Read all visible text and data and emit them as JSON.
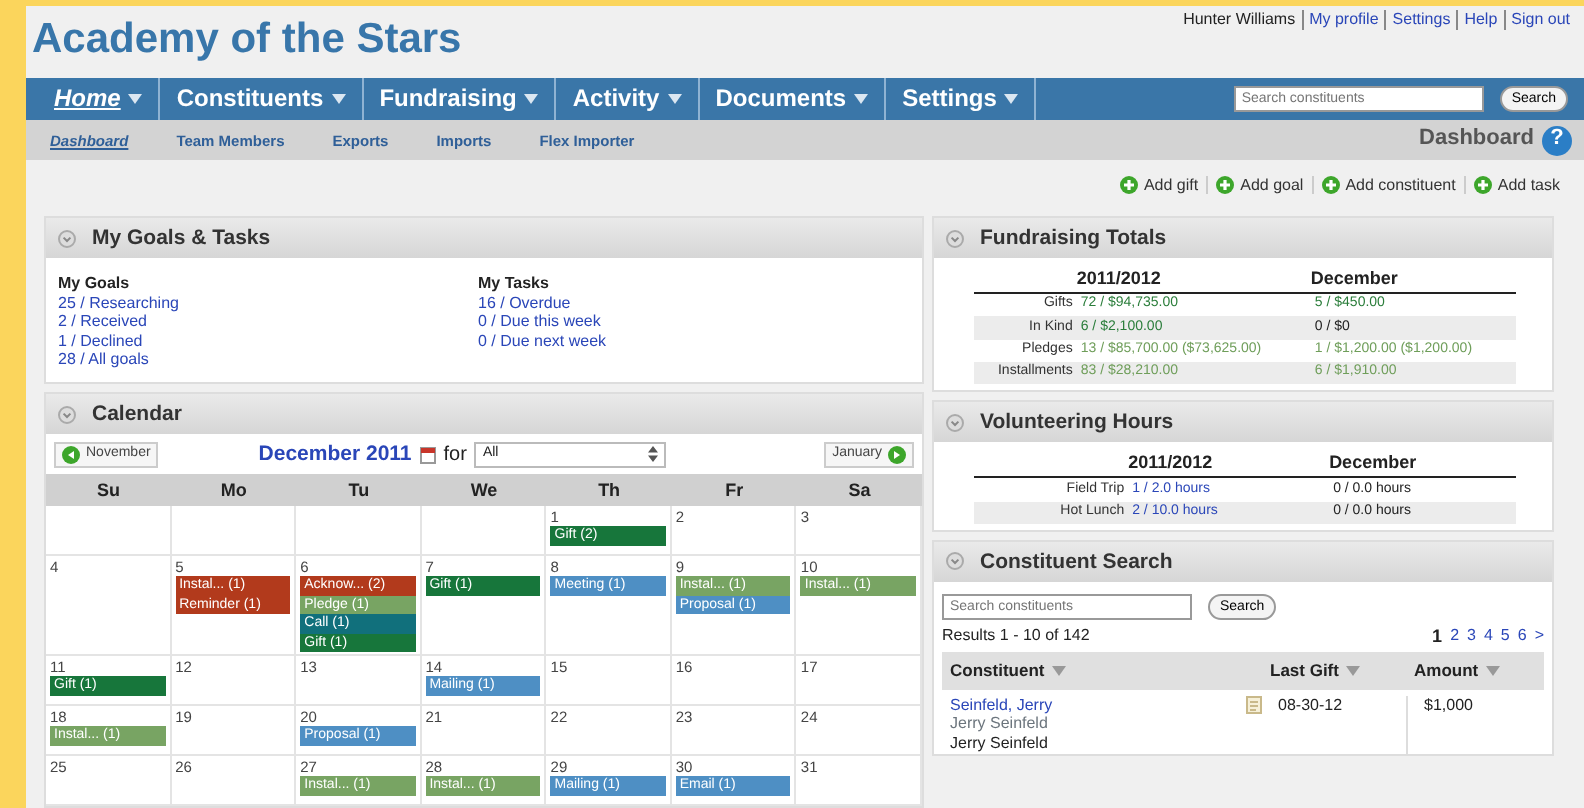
{
  "header": {
    "title": "Academy of the Stars",
    "user": "Hunter Williams",
    "links": [
      "My profile",
      "Settings",
      "Help",
      "Sign out"
    ]
  },
  "nav": {
    "items": [
      {
        "label": "Home",
        "selected": true
      },
      {
        "label": "Constituents",
        "selected": false
      },
      {
        "label": "Fundraising",
        "selected": false
      },
      {
        "label": "Activity",
        "selected": false
      },
      {
        "label": "Documents",
        "selected": false
      },
      {
        "label": "Settings",
        "selected": false
      }
    ],
    "search": {
      "placeholder": "Search constituents"
    },
    "search_button": "Search"
  },
  "subnav": {
    "items": [
      {
        "label": "Dashboard",
        "selected": true
      },
      {
        "label": "Team Members",
        "selected": false
      },
      {
        "label": "Exports",
        "selected": false
      },
      {
        "label": "Imports",
        "selected": false
      },
      {
        "label": "Flex Importer",
        "selected": false
      }
    ],
    "page_title": "Dashboard",
    "help": "?"
  },
  "actions": [
    "Add gift",
    "Add goal",
    "Add constituent",
    "Add task"
  ],
  "goals_panel": {
    "title": "My Goals & Tasks",
    "columns": [
      {
        "heading": "My Goals",
        "links": [
          "25 / Researching",
          "2 / Received",
          "1 / Declined",
          "28 / All goals"
        ]
      },
      {
        "heading": "My Tasks",
        "links": [
          "16 / Overdue",
          "0 / Due this week",
          "0 / Due next week"
        ]
      }
    ]
  },
  "calendar": {
    "title": "Calendar",
    "prev": "November",
    "month": "December 2011",
    "for": "for",
    "filter": "All",
    "next": "January",
    "weekdays": [
      "Su",
      "Mo",
      "Tu",
      "We",
      "Th",
      "Fr",
      "Sa"
    ],
    "weeks": [
      {
        "days": [
          {
            "kind": "blank"
          },
          {
            "kind": "blank"
          },
          {
            "kind": "blank"
          },
          {
            "kind": "blank"
          },
          {
            "kind": "date",
            "day": "1",
            "events": [
              {
                "label": "Gift (2)",
                "color": "#17763b"
              }
            ]
          },
          {
            "day": "2"
          },
          {
            "day": "3"
          }
        ]
      },
      {
        "days": [
          {
            "day": "4"
          },
          {
            "day": "5",
            "events": [
              {
                "label": "Instal... (1)",
                "color": "#b23a1c"
              },
              {
                "label": "Reminder (1)",
                "color": "#b23a1c"
              }
            ]
          },
          {
            "day": "6",
            "events": [
              {
                "label": "Acknow... (2)",
                "color": "#b23a1c"
              },
              {
                "label": "Pledge (1)",
                "color": "#78a463"
              },
              {
                "label": "Call (1)",
                "color": "#11707c"
              },
              {
                "label": "Gift (1)",
                "color": "#17763b"
              }
            ]
          },
          {
            "day": "7",
            "events": [
              {
                "label": "Gift (1)",
                "color": "#17763b"
              }
            ]
          },
          {
            "day": "8",
            "events": [
              {
                "label": "Meeting (1)",
                "color": "#4e8fc4"
              }
            ]
          },
          {
            "day": "9",
            "events": [
              {
                "label": "Instal... (1)",
                "color": "#78a463"
              },
              {
                "label": "Proposal (1)",
                "color": "#4e8fc4"
              }
            ]
          },
          {
            "day": "10",
            "events": [
              {
                "label": "Instal... (1)",
                "color": "#78a463"
              }
            ]
          }
        ]
      },
      {
        "days": [
          {
            "day": "11",
            "events": [
              {
                "label": "Gift (1)",
                "color": "#17763b"
              }
            ]
          },
          {
            "day": "12"
          },
          {
            "day": "13"
          },
          {
            "day": "14",
            "events": [
              {
                "label": "Mailing (1)",
                "color": "#4e8fc4"
              }
            ]
          },
          {
            "day": "15"
          },
          {
            "day": "16"
          },
          {
            "day": "17"
          }
        ]
      },
      {
        "days": [
          {
            "day": "18",
            "events": [
              {
                "label": "Instal... (1)",
                "color": "#78a463"
              }
            ]
          },
          {
            "day": "19"
          },
          {
            "day": "20",
            "events": [
              {
                "label": "Proposal (1)",
                "color": "#4e8fc4"
              }
            ]
          },
          {
            "day": "21"
          },
          {
            "day": "22"
          },
          {
            "day": "23"
          },
          {
            "day": "24"
          }
        ]
      },
      {
        "days": [
          {
            "day": "25"
          },
          {
            "day": "26"
          },
          {
            "day": "27",
            "events": [
              {
                "label": "Instal... (1)",
                "color": "#78a463"
              }
            ]
          },
          {
            "day": "28",
            "events": [
              {
                "label": "Instal... (1)",
                "color": "#78a463"
              }
            ]
          },
          {
            "day": "29",
            "events": [
              {
                "label": "Mailing (1)",
                "color": "#4e8fc4"
              }
            ]
          },
          {
            "day": "30",
            "events": [
              {
                "label": "Email (1)",
                "color": "#4e8fc4"
              }
            ]
          },
          {
            "day": "31"
          }
        ]
      }
    ]
  },
  "fundraising": {
    "title": "Fundraising Totals",
    "columns": [
      "2011/2012",
      "December"
    ],
    "rows": [
      {
        "label": "Gifts",
        "cells": [
          {
            "text": "72 / $94,735.00",
            "color": "#2a7d3a"
          },
          {
            "text": "5 / $450.00",
            "color": "#2a7d3a"
          }
        ]
      },
      {
        "label": "In Kind",
        "cells": [
          {
            "text": "6 / $2,100.00",
            "color": "#2a7d3a"
          },
          {
            "text": "0 / $0",
            "color": "#222222"
          }
        ]
      },
      {
        "label": "Pledges",
        "cells": [
          {
            "text": "13 / $85,700.00 ($73,625.00)",
            "color": "#6f9e5a"
          },
          {
            "text": "1 / $1,200.00 ($1,200.00)",
            "color": "#6f9e5a"
          }
        ]
      },
      {
        "label": "Installments",
        "cells": [
          {
            "text": "83 / $28,210.00",
            "color": "#6f9e5a"
          },
          {
            "text": "6 / $1,910.00",
            "color": "#6f9e5a"
          }
        ]
      }
    ]
  },
  "volunteering": {
    "title": "Volunteering Hours",
    "columns": [
      "2011/2012",
      "December"
    ],
    "rows": [
      {
        "label": "Field Trip",
        "cells": [
          {
            "text": "1 / 2.0 hours",
            "color": "#2a46b8"
          },
          {
            "text": "0 / 0.0 hours",
            "color": "#222222"
          }
        ]
      },
      {
        "label": "Hot Lunch",
        "cells": [
          {
            "text": "2 / 10.0 hours",
            "color": "#2a46b8"
          },
          {
            "text": "0 / 0.0 hours",
            "color": "#222222"
          }
        ]
      }
    ]
  },
  "constituent_search": {
    "title": "Constituent Search",
    "placeholder": "Search constituents",
    "button": "Search",
    "results": "Results 1 - 10 of 142",
    "pages": [
      {
        "label": "1",
        "selected": true
      },
      {
        "label": "2",
        "selected": false
      },
      {
        "label": "3",
        "selected": false
      },
      {
        "label": "4",
        "selected": false
      },
      {
        "label": "5",
        "selected": false
      },
      {
        "label": "6",
        "selected": false
      },
      {
        "label": ">",
        "selected": false
      }
    ],
    "columns": [
      "Constituent",
      "Last Gift",
      "Amount"
    ],
    "rows": [
      {
        "name": "Seinfeld, Jerry",
        "alias": "Jerry Seinfeld",
        "contact": "Jerry Seinfeld",
        "last_gift": "08-30-12",
        "amount": "$1,000"
      }
    ]
  }
}
